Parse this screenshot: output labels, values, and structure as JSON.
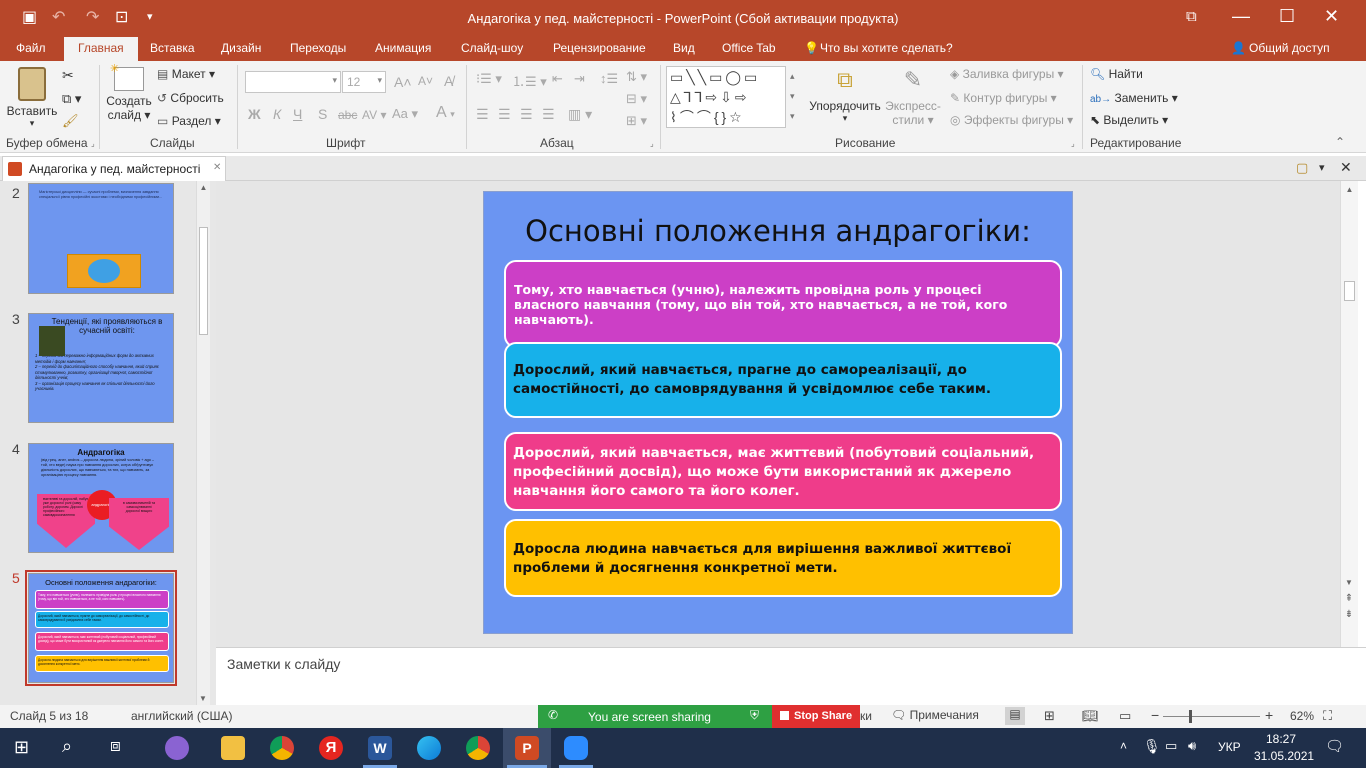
{
  "window": {
    "title": "Андагогіка у пед. майстерності - PowerPoint (Сбой активации продукта)",
    "minimize": "—",
    "restore": "☐",
    "close": "✕",
    "ribbon_display": "⧉"
  },
  "quick_access": {
    "save": "💾",
    "undo": "↶",
    "redo": "↷",
    "present": "⊡",
    "customize": "≡"
  },
  "menu": {
    "tabs": [
      "Файл",
      "Главная",
      "Вставка",
      "Дизайн",
      "Переходы",
      "Анимация",
      "Слайд-шоу",
      "Рецензирование",
      "Вид",
      "Office Tab"
    ],
    "active_tab": "Главная",
    "tell_me": "Что вы хотите сделать?",
    "share": "Общий доступ"
  },
  "ribbon": {
    "clipboard": {
      "paste": "Вставить",
      "group": "Буфер обмена"
    },
    "slides": {
      "new_slide": "Создать",
      "new_slide_2": "слайд",
      "layout": "Макет",
      "reset": "Сбросить",
      "section": "Раздел",
      "group": "Слайды"
    },
    "font": {
      "font_name": "",
      "font_size": "12",
      "group": "Шрифт",
      "bold": "Ж",
      "italic": "К",
      "underline": "Ч",
      "strike": "S",
      "abc": "abc",
      "spacing": "AV",
      "case": "Aa",
      "color": "A",
      "grow": "A",
      "shrink": "A"
    },
    "paragraph": {
      "group": "Абзац"
    },
    "drawing": {
      "arrange": "Упорядочить",
      "styles_1": "Экспресс-",
      "styles_2": "стили",
      "fill": "Заливка фигуры",
      "outline": "Контур фигуры",
      "effects": "Эффекты фигуры",
      "group": "Рисование"
    },
    "editing": {
      "find": "Найти",
      "replace": "Заменить",
      "select": "Выделить",
      "group": "Редактирование"
    }
  },
  "document_tab": {
    "label": "Андагогіка у пед. майстерності",
    "close": "✕"
  },
  "thumbnails": [
    {
      "num": "2",
      "text": "Магістерські дисципліни — сучасні проблеми, визначення завдання спеціальної рівня професійні якостями і необхідними професійними..."
    },
    {
      "num": "3",
      "title": "Тенденції, які проявляються в сучасній освіті:",
      "lines": [
        "1 – перехід від переважно інформаційних форм до активних методів і форм навчання;",
        "2 – перехід до фасилітаційного способу навчання, який сприяє стимулюванню, розвитку, організації творчої, самостійної діяльності учнів;",
        "3 – організація процесу навчання як спільної діяльності його учасників."
      ]
    },
    {
      "num": "4",
      "title": "Андрагогіка",
      "text": "(від грец. aner, andros – доросла людина, зрілий чоловік + agо – той, хто веде) наука про навчання дорослих, котра обґрунтовує діяльність дорослих, що навчаються, та тих, що навчають, за організацією процесу навчання.",
      "left_arrow": "вчителеві та дорослій, набує уже дорослої ролі (саму роботу, дорогим. Дорослі професійного самовдосконалення",
      "center": "андрагогіка",
      "right_arrow": "в самовизначеній та самооцінюванні дорослої вищого"
    },
    {
      "num": "5",
      "title": "Основні положення андрагогіки:",
      "cards": [
        "Тому, хто навчається (учню), належить провідна роль у процесі власного навчання (тому, що він той, хто навчається, а не той, кого навчають).",
        "Дорослий, який навчається, прагне до самореалізації, до самостійності, до самоврядування й усвідомлює себе таким.",
        "Дорослий, який навчається, має життєвий (побутовий соціальний, професійний досвід), що може бути використаний як джерело навчання його самого та його колег.",
        "Доросла людина навчається для вирішення важливої життєвої проблеми й досягнення конкретної мети."
      ]
    }
  ],
  "slide": {
    "title": "Основні положення андрагогіки:",
    "cards": [
      {
        "text": "Тому, хто навчається (учню), належить провідна роль у процесі власного навчання (тому, що він той, хто навчається, а не той, кого навчають).",
        "bg": "#cc3fc6",
        "fg": "#ffffff"
      },
      {
        "text": "Дорослий, який навчається, прагне до самореалізації, до самостійності, до самоврядування й усвідомлює себе таким.",
        "bg": "#17b1ea",
        "fg": "#111111"
      },
      {
        "text": "Дорослий, який навчається, має життєвий (побутовий соціальний, професійний досвід), що може бути використаний як джерело навчання його самого та його колег.",
        "bg": "#ef3c8a",
        "fg": "#ffffff"
      },
      {
        "text": "Доросла людина навчається для вирішення важливої життєвої проблеми й досягнення конкретної мети.",
        "bg": "#ffc000",
        "fg": "#111111"
      }
    ],
    "background": "#6b95f2"
  },
  "notes": {
    "placeholder": "Заметки к слайду"
  },
  "status": {
    "slide_counter": "Слайд 5 из 18",
    "language": "английский (США)",
    "sharing": "You are screen sharing",
    "stop_share": "Stop Share",
    "notes_trail": "ки",
    "comments": "Примечания",
    "zoom_minus": "−",
    "zoom_plus": "+",
    "zoom": "62%"
  },
  "taskbar": {
    "time": "18:27",
    "date": "31.05.2021",
    "lang": "УКР",
    "yandex": "Я",
    "word": "W"
  }
}
